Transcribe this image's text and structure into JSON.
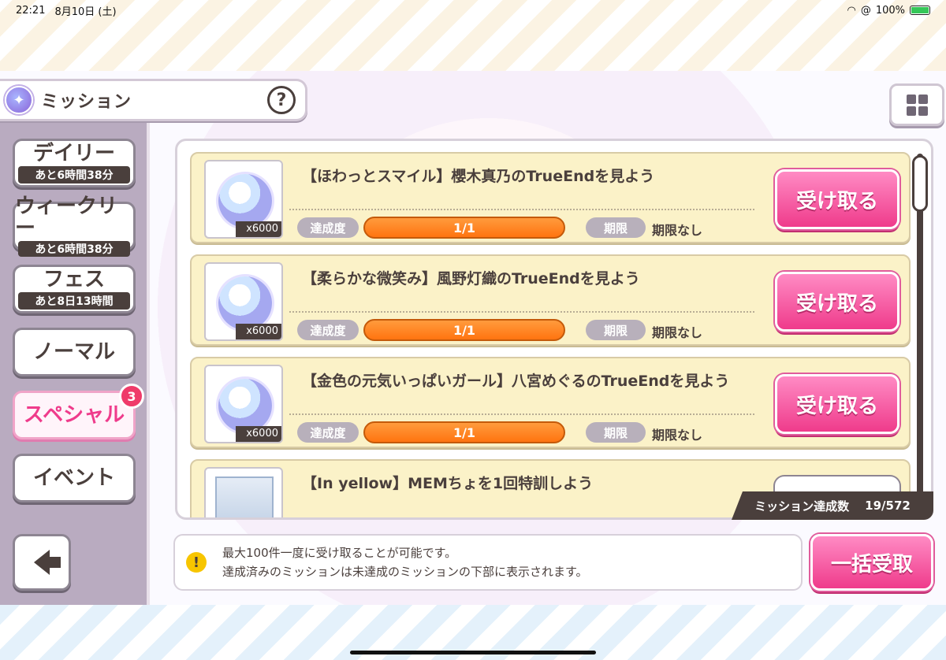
{
  "status_bar": {
    "time": "22:21",
    "date": "8月10日 (土)",
    "battery": "100%"
  },
  "header": {
    "title": "ミッション",
    "help_label": "?"
  },
  "tabs": [
    {
      "label": "デイリー",
      "sub": "あと6時間38分"
    },
    {
      "label": "ウィークリー",
      "sub": "あと6時間38分"
    },
    {
      "label": "フェス",
      "sub": "あと8日13時間"
    },
    {
      "label": "ノーマル"
    },
    {
      "label": "スペシャル",
      "badge": "3",
      "active": true
    },
    {
      "label": "イベント"
    }
  ],
  "missions": [
    {
      "title": "【ほわっとスマイル】櫻木真乃のTrueEndを見よう",
      "reward_qty": "x6000",
      "progress_label": "達成度",
      "progress": "1/1",
      "progress_fraction": 1,
      "limit_label": "期限",
      "limit": "期限なし",
      "claim_label": "受け取る"
    },
    {
      "title": "【柔らかな微笑み】風野灯織のTrueEndを見よう",
      "reward_qty": "x6000",
      "progress_label": "達成度",
      "progress": "1/1",
      "progress_fraction": 1,
      "limit_label": "期限",
      "limit": "期限なし",
      "claim_label": "受け取る"
    },
    {
      "title": "【金色の元気いっぱいガール】八宮めぐるのTrueEndを見よう",
      "reward_qty": "x6000",
      "progress_label": "達成度",
      "progress": "1/1",
      "progress_fraction": 1,
      "limit_label": "期限",
      "limit": "期限なし",
      "claim_label": "受け取る"
    },
    {
      "title": "【In yellow】MEMちょを1回特訓しよう"
    }
  ],
  "mission_count": {
    "label": "ミッション達成数",
    "value": "19/572"
  },
  "notice": {
    "line1": "最大100件一度に受け取ることが可能です。",
    "line2": "達成済みのミッションは未達成のミッションの下部に表示されます。"
  },
  "bulk_claim_label": "一括受取",
  "colors": {
    "accent_pink": "#ef3b8b",
    "progress_orange": "#ff7410",
    "card_yellow": "#fbf2c8",
    "badge_red": "#ef3b6a"
  }
}
